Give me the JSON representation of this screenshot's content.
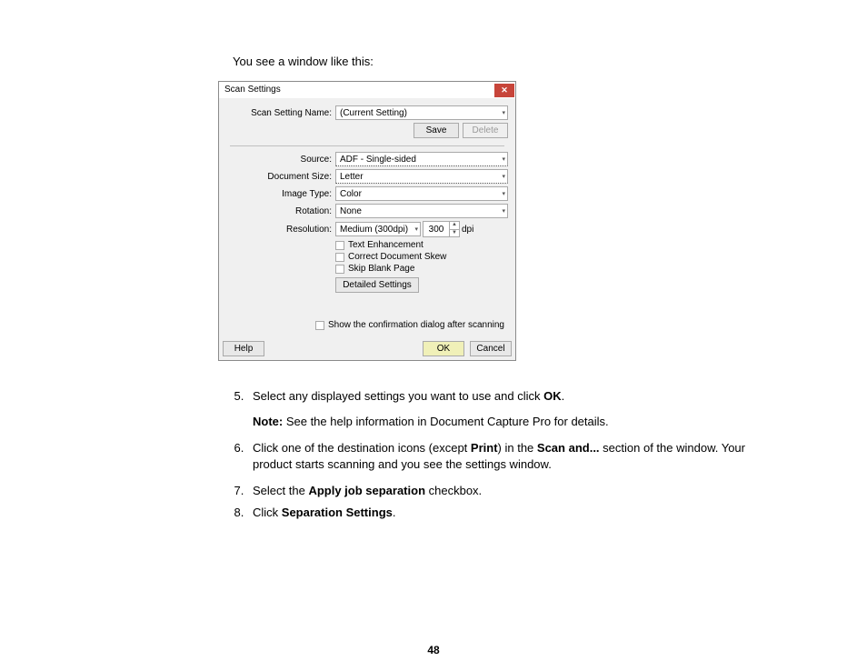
{
  "intro": "You see a window like this:",
  "dialog": {
    "title": "Scan Settings",
    "nameLabel": "Scan Setting Name:",
    "nameValue": "(Current Setting)",
    "save": "Save",
    "delete": "Delete",
    "sourceLabel": "Source:",
    "sourceValue": "ADF - Single-sided",
    "docSizeLabel": "Document Size:",
    "docSizeValue": "Letter",
    "imgTypeLabel": "Image Type:",
    "imgTypeValue": "Color",
    "rotationLabel": "Rotation:",
    "rotationValue": "None",
    "resolutionLabel": "Resolution:",
    "resolutionValue": "Medium (300dpi)",
    "resolutionDpi": "300",
    "dpi": "dpi",
    "textEnh": "Text Enhancement",
    "correctSkew": "Correct Document Skew",
    "skipBlank": "Skip Blank Page",
    "detailed": "Detailed Settings",
    "confirm": "Show the confirmation dialog after scanning",
    "help": "Help",
    "ok": "OK",
    "cancel": "Cancel"
  },
  "steps": {
    "s5a": "Select any displayed settings you want to use and click ",
    "s5b": "OK",
    "s5c": ".",
    "noteLabel": "Note:",
    "noteText": " See the help information in Document Capture Pro for details.",
    "s6a": "Click one of the destination icons (except ",
    "s6b": "Print",
    "s6c": ") in the ",
    "s6d": "Scan and...",
    "s6e": " section of the window. Your product starts scanning and you see the settings window.",
    "s7a": "Select the ",
    "s7b": "Apply job separation",
    "s7c": " checkbox.",
    "s8a": "Click ",
    "s8b": "Separation Settings",
    "s8c": "."
  },
  "pageNumber": "48"
}
